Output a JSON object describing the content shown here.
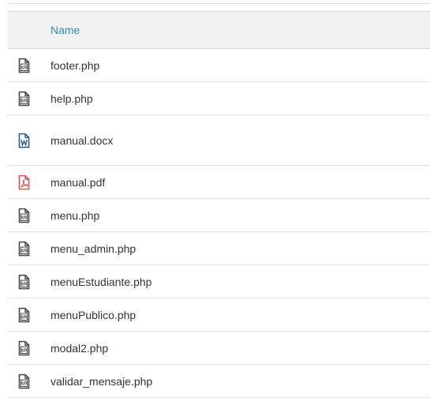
{
  "table": {
    "header": {
      "name_label": "Name"
    },
    "rows": [
      {
        "name": "footer.php",
        "icon": "code-file-icon",
        "color": "#444444"
      },
      {
        "name": "help.php",
        "icon": "code-file-icon",
        "color": "#444444"
      },
      {
        "name": "manual.docx",
        "icon": "word-file-icon",
        "color": "#2b5797"
      },
      {
        "name": "manual.pdf",
        "icon": "pdf-file-icon",
        "color": "#d9534f"
      },
      {
        "name": "menu.php",
        "icon": "code-file-icon",
        "color": "#444444"
      },
      {
        "name": "menu_admin.php",
        "icon": "code-file-icon",
        "color": "#444444"
      },
      {
        "name": "menuEstudiante.php",
        "icon": "code-file-icon",
        "color": "#444444"
      },
      {
        "name": "menuPublico.php",
        "icon": "code-file-icon",
        "color": "#444444"
      },
      {
        "name": "modal2.php",
        "icon": "code-file-icon",
        "color": "#444444"
      },
      {
        "name": "validar_mensaje.php",
        "icon": "code-file-icon",
        "color": "#444444"
      }
    ]
  }
}
